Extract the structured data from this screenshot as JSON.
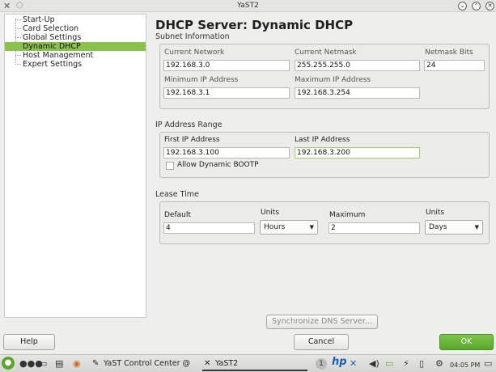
{
  "window": {
    "title": "YaST2",
    "icon": "yast-icon"
  },
  "tree": {
    "items": [
      {
        "label": "Start-Up",
        "selected": false
      },
      {
        "label": "Card Selection",
        "selected": false
      },
      {
        "label": "Global Settings",
        "selected": false
      },
      {
        "label": "Dynamic DHCP",
        "selected": true
      },
      {
        "label": "Host Management",
        "selected": false
      },
      {
        "label": "Expert Settings",
        "selected": false
      }
    ]
  },
  "page": {
    "title": "DHCP Server: Dynamic DHCP"
  },
  "subnet": {
    "label": "Subnet Information",
    "current_network_label": "Current Network",
    "current_network_value": "192.168.3.0",
    "current_netmask_label": "Current Netmask",
    "current_netmask_value": "255.255.255.0",
    "netmask_bits_label": "Netmask Bits",
    "netmask_bits_value": "24",
    "min_ip_label": "Minimum IP Address",
    "min_ip_value": "192.168.3.1",
    "max_ip_label": "Maximum IP Address",
    "max_ip_value": "192.168.3.254"
  },
  "range": {
    "label": "IP Address Range",
    "first_ip_label": "First IP Address",
    "first_ip_value": "192.168.3.100",
    "last_ip_label": "Last IP Address",
    "last_ip_value": "192.168.3.200",
    "allow_bootp_label": "Allow Dynamic BOOTP",
    "allow_bootp_checked": false
  },
  "lease": {
    "label": "Lease Time",
    "default_label": "Default",
    "default_value": "4",
    "units1_label": "Units",
    "units1_value": "Hours",
    "maximum_label": "Maximum",
    "maximum_value": "2",
    "units2_label": "Units",
    "units2_value": "Days"
  },
  "buttons": {
    "sync_dns": "Synchronize DNS Server...",
    "help": "Help",
    "cancel": "Cancel",
    "ok": "OK"
  },
  "taskbar": {
    "task1": "YaST Control Center @",
    "task2": "YaST2",
    "badge": "1",
    "clock": "04:05 PM"
  },
  "colors": {
    "accent": "#8bc34a",
    "ok_button": "#5aa62d"
  }
}
